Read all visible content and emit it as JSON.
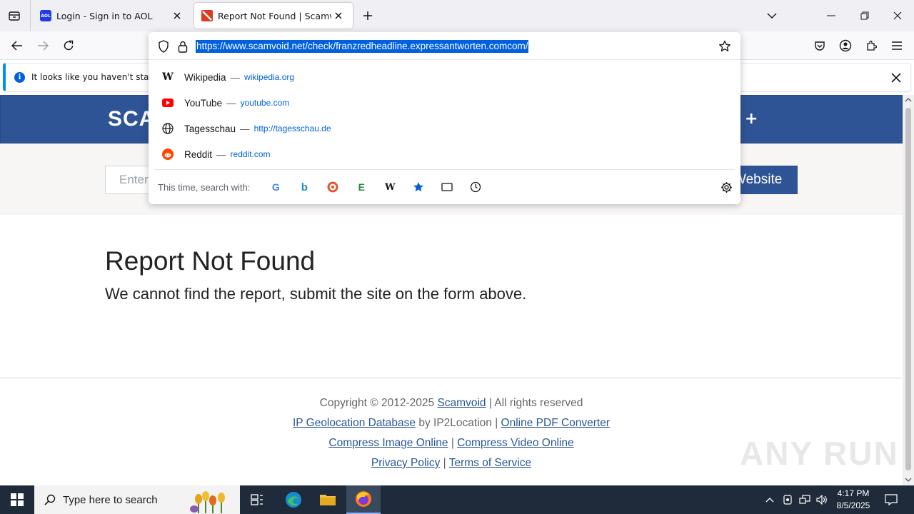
{
  "tabs": [
    {
      "title": "Login - Sign in to AOL",
      "favicon": "aol-icon",
      "active": false
    },
    {
      "title": "Report Not Found | Scamvoid",
      "favicon": "scamvoid-icon",
      "active": true
    }
  ],
  "urlbar": {
    "url": "https://www.scamvoid.net/check/franzredheadline.expressantworten.comcom/"
  },
  "suggestions": [
    {
      "title": "Wikipedia",
      "url": "wikipedia.org",
      "icon": "wikipedia-icon"
    },
    {
      "title": "YouTube",
      "url": "youtube.com",
      "icon": "youtube-icon"
    },
    {
      "title": "Tagesschau",
      "url": "http://tagesschau.de",
      "icon": "globe-icon"
    },
    {
      "title": "Reddit",
      "url": "reddit.com",
      "icon": "reddit-icon"
    }
  ],
  "search_engines": {
    "label": "This time, search with:",
    "engines": [
      "google-icon",
      "bing-icon",
      "duckduckgo-icon",
      "ecosia-icon",
      "wikipedia-icon",
      "bookmarks-icon",
      "tabs-icon",
      "history-icon"
    ]
  },
  "notification": {
    "text": "It looks like you haven't started"
  },
  "site": {
    "brand": "SCA",
    "nav_plus": "+",
    "input_placeholder": "Enter",
    "button_label": "Website",
    "heading": "Report Not Found",
    "subheading": "We cannot find the report, submit the site on the form above.",
    "footer": {
      "copyright": "Copyright © 2012-2025",
      "scamvoid_link": "Scamvoid",
      "rights": "| All rights reserved",
      "ip_geo_link": "IP Geolocation Database",
      "by_ip2": "by IP2Location |",
      "pdf_link": "Online PDF Converter",
      "compress_image_link": "Compress Image Online",
      "sep": "|",
      "compress_video_link": "Compress Video Online",
      "privacy_link": "Privacy Policy",
      "terms_link": "Terms of Service"
    }
  },
  "taskbar": {
    "search_placeholder": "Type here to search",
    "time": "4:17 PM",
    "date": "8/5/2025"
  },
  "watermark": "ANY RUN",
  "colors": {
    "site_header": "#2f5496",
    "url_highlight": "#0060df",
    "taskbar": "#1f2b3a"
  }
}
